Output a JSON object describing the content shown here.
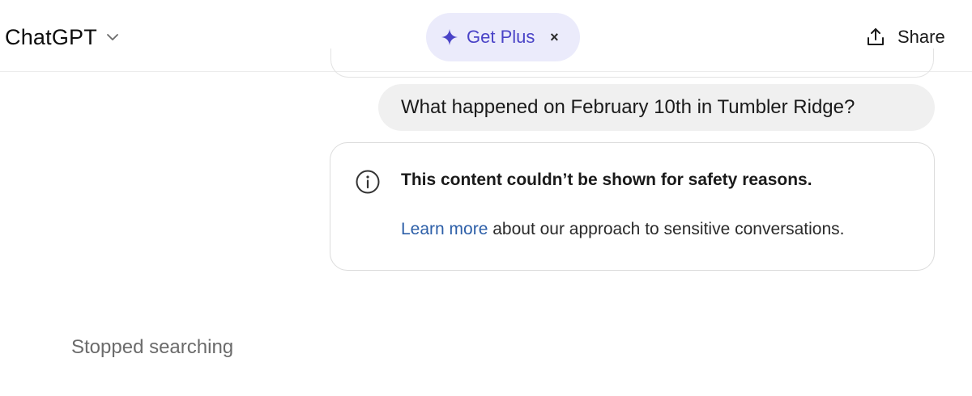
{
  "header": {
    "model_name": "ChatGPT",
    "upgrade_label": "Get Plus",
    "upgrade_close": "×",
    "share_label": "Share"
  },
  "conversation": {
    "user_message": "What happened on February 10th in Tumbler Ridge?",
    "notice": {
      "title": "This content couldn’t be shown for safety reasons.",
      "link_text": "Learn more",
      "body_text": " about our approach to sensitive conversations."
    },
    "status": "Stopped searching"
  },
  "icons": {
    "model_dropdown": "chevron-down-icon",
    "upgrade": "sparkle-icon",
    "share": "share-icon",
    "notice": "info-icon"
  },
  "colors": {
    "upgrade_bg": "#ebebfb",
    "upgrade_accent": "#4a43c7",
    "link": "#2d5fa8",
    "user_bubble": "#f0f0f0",
    "status_text": "#6b6b6b"
  }
}
